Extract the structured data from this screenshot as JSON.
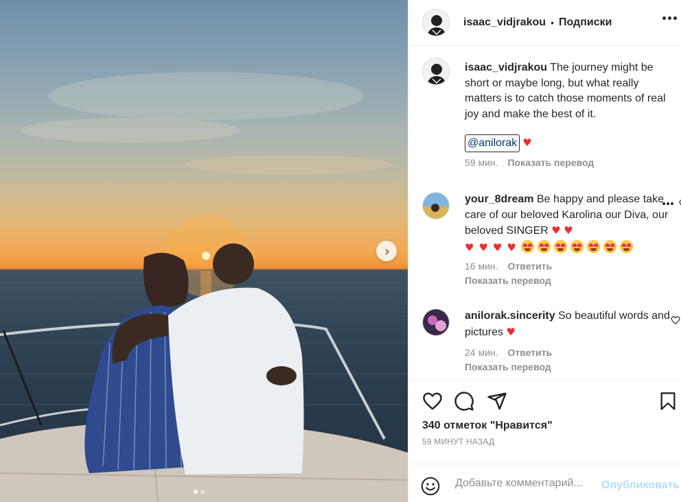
{
  "post": {
    "author": "isaac_vidjrakou",
    "follow_label": "Подписки",
    "separator": "•",
    "caption": {
      "username": "isaac_vidjrakou",
      "text": "The journey might be short or maybe long, but what really matters is to catch those moments of real joy and make the best of it.",
      "mention": "@anilorak",
      "heart": "♥",
      "time": "59 мин.",
      "translate": "Показать перевод"
    },
    "comments": [
      {
        "username": "your_8dream",
        "text": "Be happy and please take care of our beloved Karolina our Diva, our beloved SINGER",
        "heart": "♥",
        "time": "16 мин.",
        "reply": "Ответить",
        "translate": "Показать перевод"
      },
      {
        "username": "anilorak.sincerity",
        "text": "So beautiful words and pictures",
        "heart": "♥",
        "time": "24 мин.",
        "reply": "Ответить",
        "translate": "Показать перевод"
      }
    ],
    "likes": "340 отметок \"Нравится\"",
    "time_ago": "59 МИНУТ НАЗАД",
    "add_comment": {
      "placeholder": "Добавьте комментарий...",
      "publish": "Опубликовать"
    },
    "carousel": {
      "total": 2,
      "current": 1
    }
  },
  "colors": {
    "text": "#262626",
    "secondary": "#8e8e8e",
    "heart": "#ed2e2e",
    "mention": "#00376b",
    "publish_disabled": "#b2dffc",
    "border": "#efefef"
  },
  "icons": [
    "more-icon",
    "chevron-right-icon",
    "heart-icon",
    "comment-icon",
    "share-icon",
    "bookmark-icon",
    "emoji-icon"
  ]
}
